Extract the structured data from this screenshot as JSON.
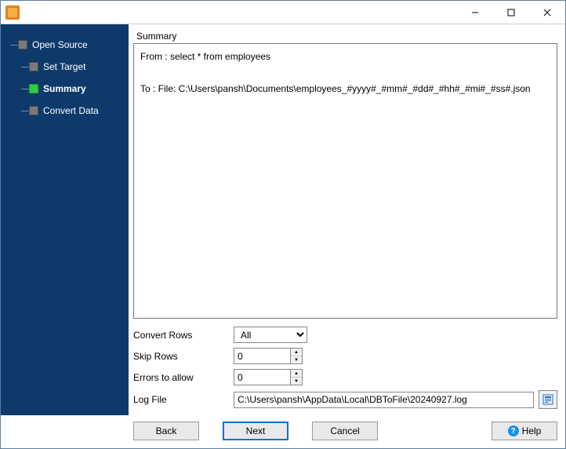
{
  "sidebar": {
    "items": [
      {
        "label": "Open Source",
        "active": false
      },
      {
        "label": "Set Target",
        "active": false
      },
      {
        "label": "Summary",
        "active": true
      },
      {
        "label": "Convert Data",
        "active": false
      }
    ]
  },
  "summary": {
    "title": "Summary",
    "from_line": "From : select * from employees",
    "to_line": "To : File: C:\\Users\\pansh\\Documents\\employees_#yyyy#_#mm#_#dd#_#hh#_#mi#_#ss#.json"
  },
  "form": {
    "convert_rows_label": "Convert Rows",
    "convert_rows_value": "All",
    "skip_rows_label": "Skip Rows",
    "skip_rows_value": "0",
    "errors_label": "Errors to allow",
    "errors_value": "0",
    "log_file_label": "Log File",
    "log_file_value": "C:\\Users\\pansh\\AppData\\Local\\DBToFile\\20240927.log"
  },
  "buttons": {
    "back": "Back",
    "next": "Next",
    "cancel": "Cancel",
    "help": "Help"
  }
}
